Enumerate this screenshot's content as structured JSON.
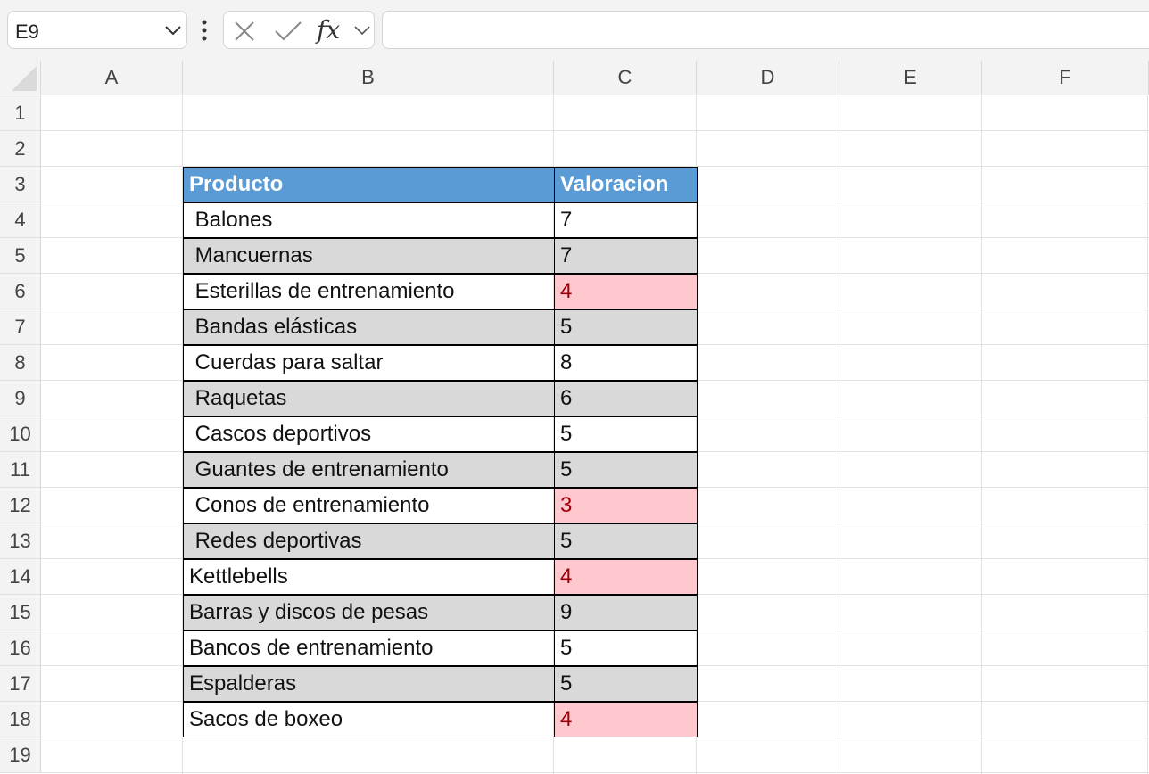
{
  "formula_bar": {
    "name_box": "E9",
    "cancel_icon": "cancel-x-icon",
    "enter_icon": "checkmark-icon",
    "fx_label": "fx",
    "formula": ""
  },
  "columns": [
    "A",
    "B",
    "C",
    "D",
    "E",
    "F"
  ],
  "rows": [
    "1",
    "2",
    "3",
    "4",
    "5",
    "6",
    "7",
    "8",
    "9",
    "10",
    "11",
    "12",
    "13",
    "14",
    "15",
    "16",
    "17",
    "18",
    "19"
  ],
  "table": {
    "header": {
      "producto": "Producto",
      "valoracion": "Valoracion"
    },
    "rows": [
      {
        "producto": " Balones",
        "valoracion": "7",
        "style": "white"
      },
      {
        "producto": " Mancuernas",
        "valoracion": "7",
        "style": "gray"
      },
      {
        "producto": " Esterillas de entrenamiento",
        "valoracion": "4",
        "style": "white-low"
      },
      {
        "producto": " Bandas elásticas",
        "valoracion": "5",
        "style": "gray"
      },
      {
        "producto": " Cuerdas para saltar",
        "valoracion": "8",
        "style": "white"
      },
      {
        "producto": " Raquetas",
        "valoracion": "6",
        "style": "gray"
      },
      {
        "producto": " Cascos deportivos",
        "valoracion": "5",
        "style": "white"
      },
      {
        "producto": " Guantes de entrenamiento",
        "valoracion": "5",
        "style": "gray"
      },
      {
        "producto": " Conos de entrenamiento",
        "valoracion": "3",
        "style": "white-low"
      },
      {
        "producto": " Redes deportivas",
        "valoracion": "5",
        "style": "gray"
      },
      {
        "producto": "Kettlebells",
        "valoracion": "4",
        "style": "white-low"
      },
      {
        "producto": "Barras y discos de pesas",
        "valoracion": "9",
        "style": "gray"
      },
      {
        "producto": "Bancos de entrenamiento",
        "valoracion": "5",
        "style": "white"
      },
      {
        "producto": "Espalderas",
        "valoracion": "5",
        "style": "gray"
      },
      {
        "producto": "Sacos de boxeo",
        "valoracion": "4",
        "style": "white-low"
      }
    ]
  },
  "colors": {
    "header_fill": "#5b9bd5",
    "band_fill": "#d9d9d9",
    "low_fill": "#ffc7ce",
    "low_text": "#9c0006"
  }
}
